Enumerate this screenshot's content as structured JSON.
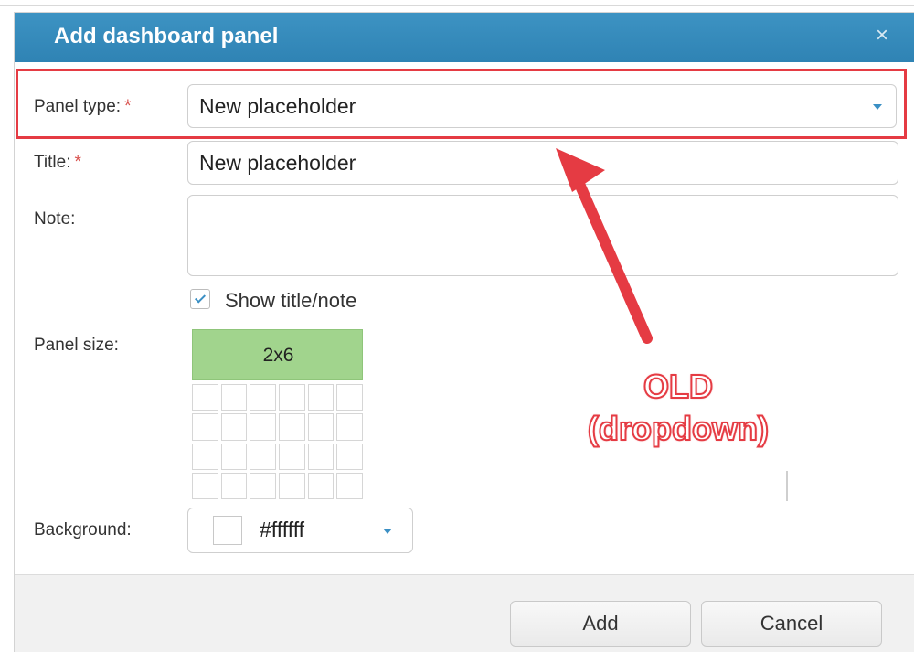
{
  "dialog": {
    "title": "Add dashboard panel",
    "close_glyph": "×",
    "close_icon": "close-icon"
  },
  "form": {
    "panel_type": {
      "label": "Panel type:",
      "required_mark": "*",
      "value": "New placeholder",
      "icon": "chevron-down-icon"
    },
    "title": {
      "label": "Title:",
      "required_mark": "*",
      "value": "New placeholder"
    },
    "note": {
      "label": "Note:",
      "value": ""
    },
    "show_title_note": {
      "label": "Show title/note",
      "checked": true,
      "icon": "check-icon"
    },
    "panel_size": {
      "label": "Panel size:",
      "value": "2x6",
      "grid_rows": 4,
      "grid_cols": 6
    },
    "background": {
      "label": "Background:",
      "value": "#ffffff",
      "swatch_color": "#ffffff",
      "icon": "chevron-down-icon"
    }
  },
  "footer": {
    "add_label": "Add",
    "cancel_label": "Cancel"
  },
  "annotation": {
    "line1": "OLD",
    "line2": "(dropdown)",
    "color": "#e53b43",
    "arrow_icon": "arrow-icon"
  },
  "colors": {
    "titlebar": "#2f83b4",
    "accent": "#3a8fc4",
    "selected_size": "#a1d48d",
    "highlight": "#e53b43"
  }
}
